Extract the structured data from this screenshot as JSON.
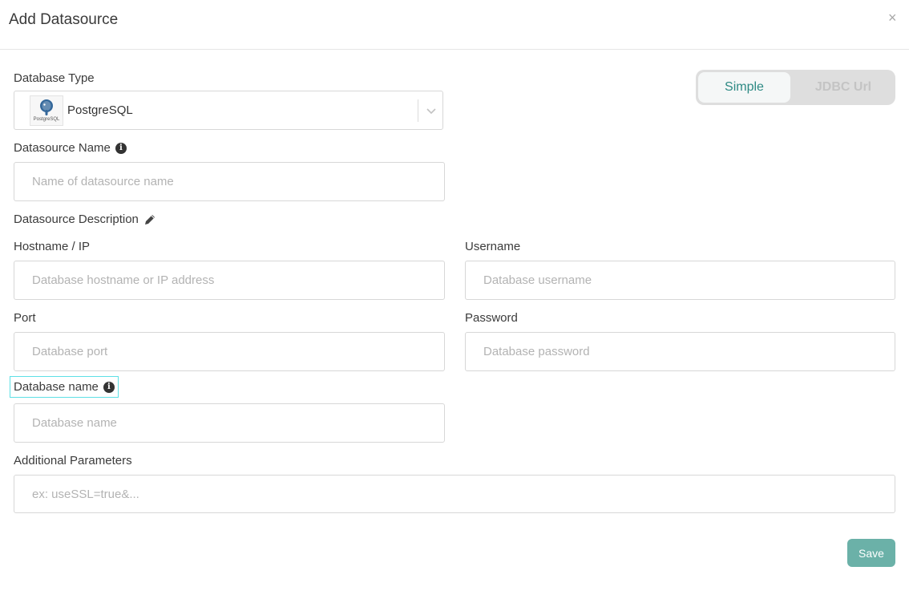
{
  "dialog": {
    "title": "Add Datasource",
    "close_label": "×"
  },
  "mode_toggle": {
    "simple_label": "Simple",
    "jdbc_label": "JDBC Url",
    "selected": "Simple"
  },
  "database_type": {
    "label": "Database Type",
    "value": "PostgreSQL",
    "logo_text": "PostgreSQL"
  },
  "datasource_name": {
    "label": "Datasource Name",
    "placeholder": "Name of datasource name",
    "info": "i"
  },
  "datasource_description": {
    "label": "Datasource Description"
  },
  "hostname": {
    "label": "Hostname / IP",
    "placeholder": "Database hostname or IP address"
  },
  "username": {
    "label": "Username",
    "placeholder": "Database username"
  },
  "port": {
    "label": "Port",
    "placeholder": "Database port"
  },
  "password": {
    "label": "Password",
    "placeholder": "Database password"
  },
  "database_name": {
    "label": "Database name",
    "placeholder": "Database name",
    "info": "i"
  },
  "additional_parameters": {
    "label": "Additional Parameters",
    "placeholder": "ex: useSSL=true&..."
  },
  "actions": {
    "save_label": "Save"
  },
  "colors": {
    "accent": "#6bb1a8",
    "toggle_active_text": "#2e8a84",
    "focus_outline": "#5ee0e6"
  },
  "icons": {
    "close": "close-icon",
    "info": "info-icon",
    "edit": "pencil-icon",
    "dropdown": "chevron-down-icon",
    "logo": "postgresql-logo-icon"
  }
}
